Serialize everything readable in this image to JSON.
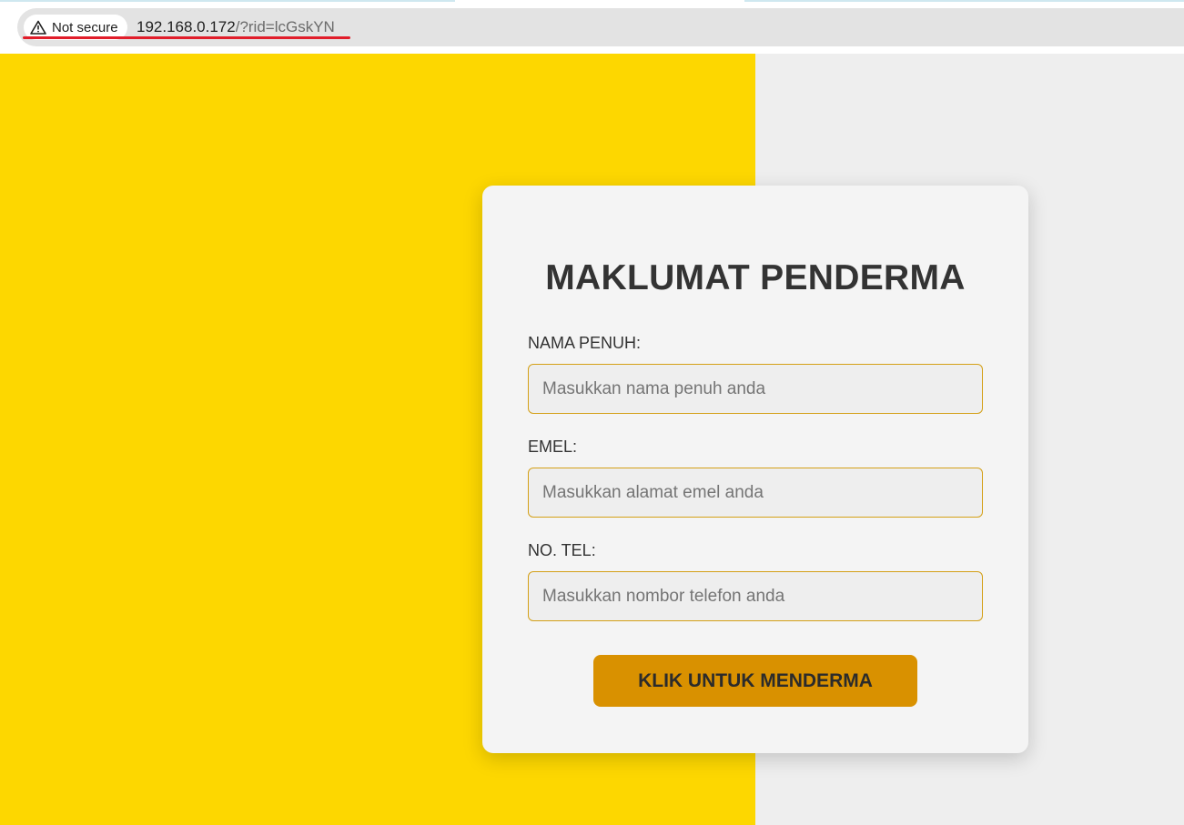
{
  "browser": {
    "security_label": "Not secure",
    "url_host": "192.168.0.172",
    "url_path": "/?rid=lcGskYN"
  },
  "colors": {
    "left_panel": "#fdd700",
    "right_panel": "#eeeeee",
    "card": "#f4f4f4",
    "input_border": "#d4a017",
    "button": "#d99100",
    "warning_underline": "#e11d2a"
  },
  "form": {
    "title": "MAKLUMAT PENDERMA",
    "fields": [
      {
        "label": "NAMA PENUH:",
        "placeholder": "Masukkan nama penuh anda",
        "value": ""
      },
      {
        "label": "EMEL:",
        "placeholder": "Masukkan alamat emel anda",
        "value": ""
      },
      {
        "label": "NO. TEL:",
        "placeholder": "Masukkan nombor telefon anda",
        "value": ""
      }
    ],
    "submit_label": "KLIK UNTUK MENDERMA"
  }
}
